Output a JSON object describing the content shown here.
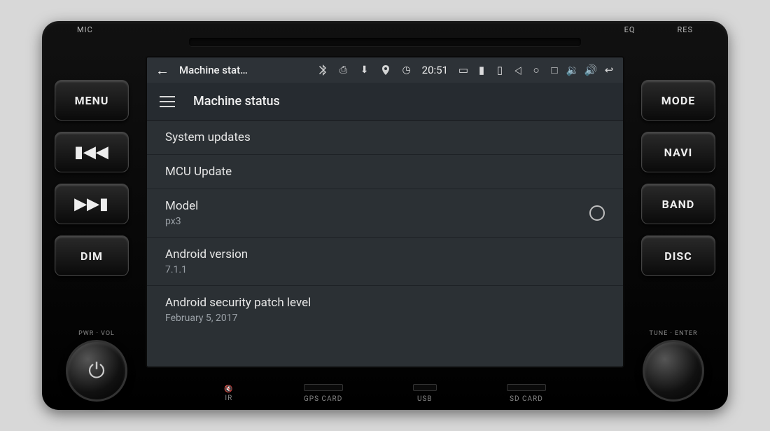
{
  "hardware": {
    "top_left_label": "MIC",
    "top_eq_label": "EQ",
    "top_res_label": "RES",
    "left_buttons": [
      "MENU",
      "prev",
      "next",
      "DIM"
    ],
    "right_buttons": [
      "MODE",
      "NAVI",
      "BAND",
      "DISC"
    ],
    "left_knob_label": "PWR · VOL",
    "right_knob_label": "TUNE · ENTER",
    "bottom_ir_label": "IR",
    "ports": [
      "GPS CARD",
      "USB",
      "SD CARD"
    ]
  },
  "status_bar": {
    "title": "Machine stat…",
    "time": "20:51",
    "bluetooth_icon": "bluetooth",
    "location_icon": "location",
    "usb_icon": "usb",
    "battery_icon": "battery"
  },
  "app_header": {
    "title": "Machine status"
  },
  "settings": [
    {
      "primary": "System updates"
    },
    {
      "primary": "MCU Update"
    },
    {
      "primary": "Model",
      "secondary": "px3",
      "radio": true
    },
    {
      "primary": "Android version",
      "secondary": "7.1.1"
    },
    {
      "primary": "Android security patch level",
      "secondary": "February 5, 2017"
    }
  ]
}
